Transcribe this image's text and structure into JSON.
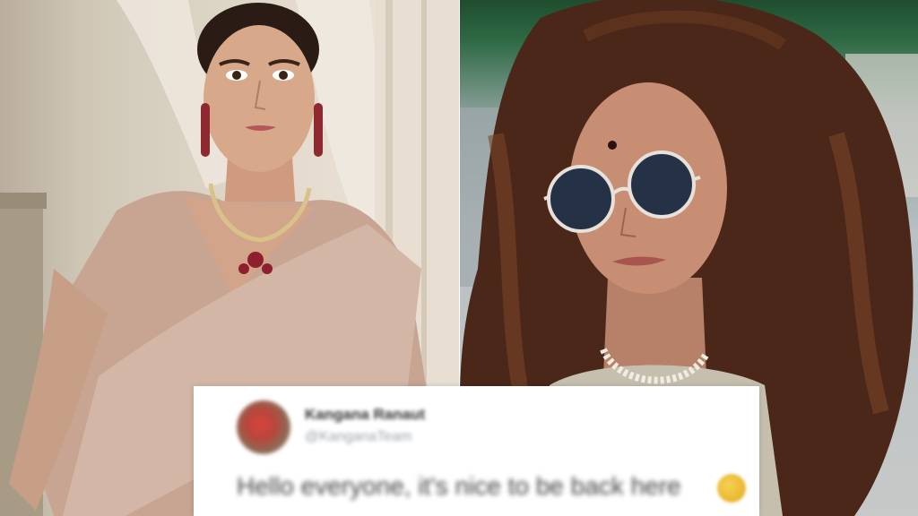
{
  "images": {
    "left_photo": {
      "description_icon": "woman-portrait-icon"
    },
    "right_photo": {
      "description_icon": "woman-sunglasses-portrait-icon"
    }
  },
  "tweet": {
    "display_name": "Kangana Ranaut",
    "handle": "@KanganaTeam",
    "text": "Hello everyone, it's nice to be back here",
    "emoji_icon": "smiling-face-emoji-icon",
    "avatar_icon": "avatar-icon"
  },
  "colors": {
    "left_background": "#d9d2c2",
    "right_background": "#b8c0c3",
    "saree": "#c8a593",
    "hair_right": "#4a2718",
    "tweet_background": "#ffffff"
  }
}
